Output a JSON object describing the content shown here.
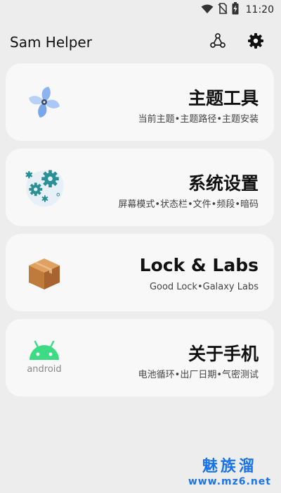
{
  "status_bar": {
    "time": "11:20",
    "icons": [
      "wifi-icon",
      "no-sim-icon",
      "battery-charging-icon"
    ]
  },
  "app_bar": {
    "title": "Sam Helper",
    "actions": [
      "share-nodes-icon",
      "gear-icon"
    ]
  },
  "cards": [
    {
      "title": "主题工具",
      "subtitle": "当前主题•主题路径•主题安装",
      "icon": "pinwheel-icon"
    },
    {
      "title": "系统设置",
      "subtitle": "屏幕模式•状态栏•文件•频段•暗码",
      "icon": "gears-icon"
    },
    {
      "title": "Lock & Labs",
      "subtitle": "Good Lock•Galaxy Labs",
      "icon": "box-icon"
    },
    {
      "title": "关于手机",
      "subtitle": "电池循环•出厂日期•气密测试",
      "icon": "android-icon",
      "icon_text": "android"
    }
  ],
  "watermark": {
    "top": "魅族溜",
    "bottom": "www.mz6.net"
  },
  "colors": {
    "background": "#ededed",
    "card": "#f8f8f8",
    "teal": "#2b8f96",
    "android_green": "#3ddc84",
    "watermark_blue": "#1a73e8"
  }
}
